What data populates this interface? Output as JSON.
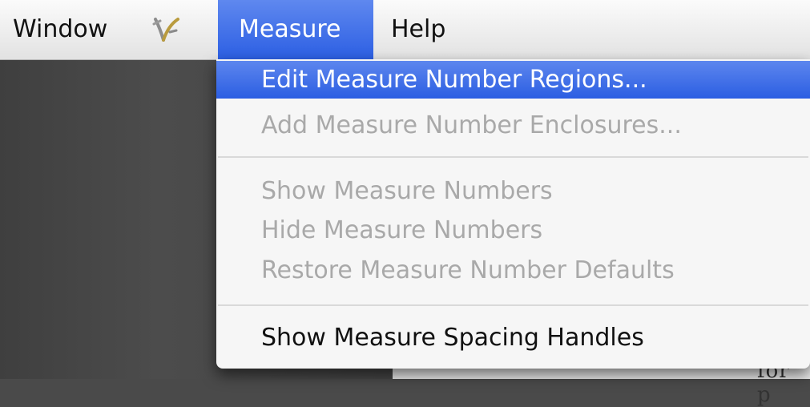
{
  "menubar": {
    "items": [
      {
        "label": "Window"
      },
      {
        "label": "Measure",
        "selected": true
      },
      {
        "label": "Help"
      }
    ],
    "script_icon": "script-icon"
  },
  "menu": {
    "items": [
      {
        "label": "Edit Measure Number Regions...",
        "state": "highlighted"
      },
      {
        "label": "Add Measure Number Enclosures...",
        "state": "disabled"
      },
      {
        "label": "Show Measure Numbers",
        "state": "disabled"
      },
      {
        "label": "Hide Measure Numbers",
        "state": "disabled"
      },
      {
        "label": "Restore Measure Number Defaults",
        "state": "disabled"
      },
      {
        "label": "Show Measure Spacing Handles",
        "state": "enabled"
      }
    ]
  },
  "background": {
    "peek_text": "for p"
  },
  "colors": {
    "highlight": "#2c5fe3",
    "disabled_text": "#a9a9a9"
  }
}
